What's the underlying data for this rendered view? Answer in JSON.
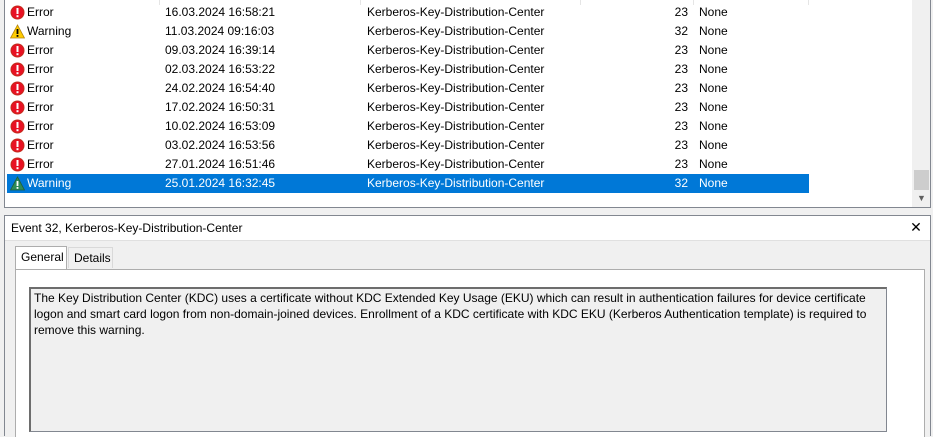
{
  "events": [
    {
      "level": "Error",
      "icon": "error-icon",
      "date": "16.03.2024 16:58:21",
      "source": "Kerberos-Key-Distribution-Center",
      "id": "23",
      "task": "None"
    },
    {
      "level": "Warning",
      "icon": "warning-icon",
      "date": "11.03.2024 09:16:03",
      "source": "Kerberos-Key-Distribution-Center",
      "id": "32",
      "task": "None"
    },
    {
      "level": "Error",
      "icon": "error-icon",
      "date": "09.03.2024 16:39:14",
      "source": "Kerberos-Key-Distribution-Center",
      "id": "23",
      "task": "None"
    },
    {
      "level": "Error",
      "icon": "error-icon",
      "date": "02.03.2024 16:53:22",
      "source": "Kerberos-Key-Distribution-Center",
      "id": "23",
      "task": "None"
    },
    {
      "level": "Error",
      "icon": "error-icon",
      "date": "24.02.2024 16:54:40",
      "source": "Kerberos-Key-Distribution-Center",
      "id": "23",
      "task": "None"
    },
    {
      "level": "Error",
      "icon": "error-icon",
      "date": "17.02.2024 16:50:31",
      "source": "Kerberos-Key-Distribution-Center",
      "id": "23",
      "task": "None"
    },
    {
      "level": "Error",
      "icon": "error-icon",
      "date": "10.02.2024 16:53:09",
      "source": "Kerberos-Key-Distribution-Center",
      "id": "23",
      "task": "None"
    },
    {
      "level": "Error",
      "icon": "error-icon",
      "date": "03.02.2024 16:53:56",
      "source": "Kerberos-Key-Distribution-Center",
      "id": "23",
      "task": "None"
    },
    {
      "level": "Error",
      "icon": "error-icon",
      "date": "27.01.2024 16:51:46",
      "source": "Kerberos-Key-Distribution-Center",
      "id": "23",
      "task": "None"
    },
    {
      "level": "Warning",
      "icon": "warning-icon",
      "date": "25.01.2024 16:32:45",
      "source": "Kerberos-Key-Distribution-Center",
      "id": "32",
      "task": "None",
      "selected": true
    }
  ],
  "detail": {
    "title": "Event 32, Kerberos-Key-Distribution-Center",
    "close_icon": "close-icon",
    "tabs": [
      {
        "label": "General",
        "active": true
      },
      {
        "label": "Details",
        "active": false
      }
    ],
    "description": "The Key Distribution Center (KDC) uses a certificate without KDC Extended Key Usage (EKU) which can result in authentication failures for device certificate logon and smart card logon from non-domain-joined devices. Enrollment of a KDC certificate with KDC EKU (Kerberos Authentication template) is required to remove this warning."
  },
  "colors": {
    "selection": "#0078d7",
    "error": "#e81123",
    "warning_yellow": "#ffcc00",
    "warning_green": "#2e8b57"
  }
}
